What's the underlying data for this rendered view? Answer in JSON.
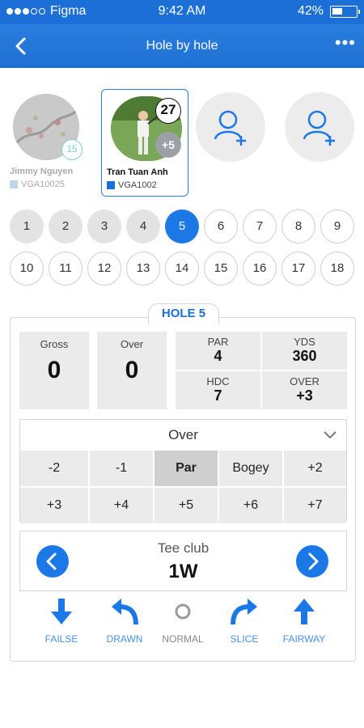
{
  "status_bar": {
    "carrier": "Figma",
    "time": "9:42 AM",
    "battery": "42%"
  },
  "nav": {
    "title": "Hole by hole",
    "more": "•••"
  },
  "players": [
    {
      "name": "Jimmy Nguyen",
      "code": "VGA10025",
      "badge": "15",
      "color": "#bcd6f2"
    },
    {
      "name": "Tran Tuan Anh",
      "code": "VGA1002",
      "badge_top": "27",
      "badge_bottom": "+5",
      "color": "#1b6fd6"
    }
  ],
  "holes_row1": [
    "1",
    "2",
    "3",
    "4",
    "5",
    "6",
    "7",
    "8",
    "9"
  ],
  "holes_row2": [
    "10",
    "11",
    "12",
    "13",
    "14",
    "15",
    "16",
    "17",
    "18"
  ],
  "hole_panel": {
    "title": "HOLE 5",
    "gross_label": "Gross",
    "gross_value": "0",
    "over_label": "Over",
    "over_value": "0",
    "par_label": "PAR",
    "par_value": "4",
    "yds_label": "YDS",
    "yds_value": "360",
    "hdc_label": "HDC",
    "hdc_value": "7",
    "over2_label": "OVER",
    "over2_value": "+3"
  },
  "over_select": {
    "label": "Over",
    "row1": [
      "-2",
      "-1",
      "Par",
      "Bogey",
      "+2"
    ],
    "row2": [
      "+3",
      "+4",
      "+5",
      "+6",
      "+7"
    ],
    "selected": "Par"
  },
  "tee_club": {
    "label": "Tee club",
    "value": "1W"
  },
  "shot_types": [
    "FAILSE",
    "DRAWN",
    "NORMAL",
    "SLICE",
    "FAIRWAY"
  ],
  "colors": {
    "primary": "#1b6fd6",
    "accent": "#1b78e6",
    "panel_gray": "#ebebeb"
  }
}
